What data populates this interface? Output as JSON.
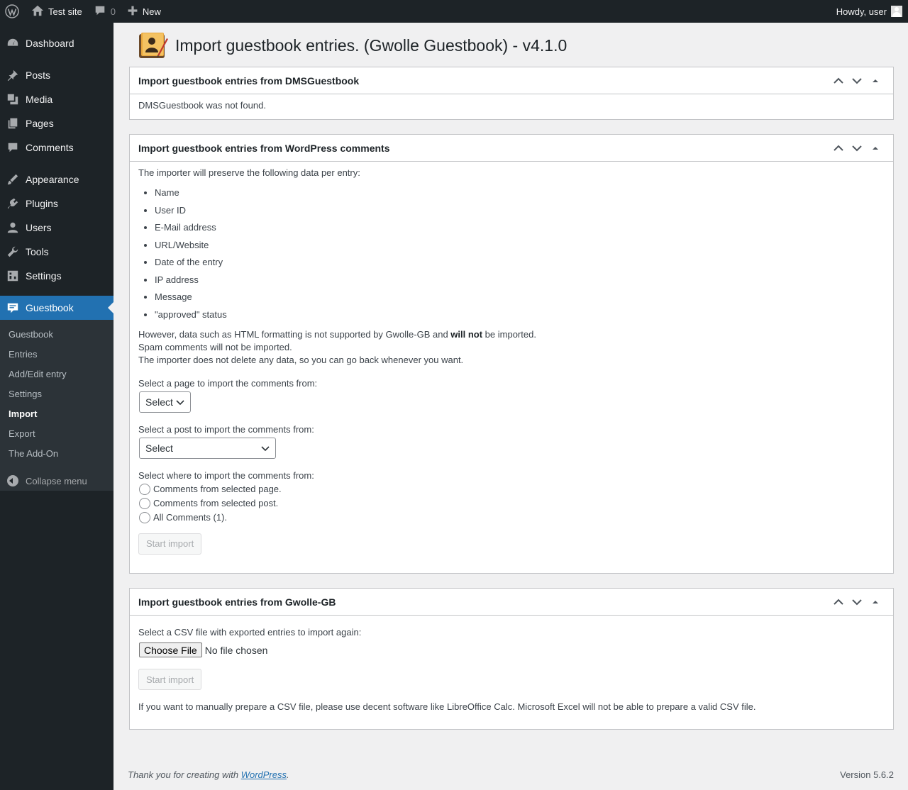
{
  "adminbar": {
    "site_name": "Test site",
    "comments_count": "0",
    "new_label": "New",
    "howdy": "Howdy, user"
  },
  "sidebar": {
    "items": [
      {
        "label": "Dashboard",
        "icon": "dashboard-icon"
      },
      {
        "label": "Posts",
        "icon": "pin-icon"
      },
      {
        "label": "Media",
        "icon": "media-icon"
      },
      {
        "label": "Pages",
        "icon": "pages-icon"
      },
      {
        "label": "Comments",
        "icon": "comment-icon"
      },
      {
        "label": "Appearance",
        "icon": "brush-icon"
      },
      {
        "label": "Plugins",
        "icon": "plugin-icon"
      },
      {
        "label": "Users",
        "icon": "user-icon"
      },
      {
        "label": "Tools",
        "icon": "wrench-icon"
      },
      {
        "label": "Settings",
        "icon": "settings-icon"
      },
      {
        "label": "Guestbook",
        "icon": "guestbook-icon"
      }
    ],
    "submenu": [
      "Guestbook",
      "Entries",
      "Add/Edit entry",
      "Settings",
      "Import",
      "Export",
      "The Add-On"
    ],
    "collapse": "Collapse menu"
  },
  "page": {
    "title": "Import guestbook entries. (Gwolle Guestbook) - v4.1.0"
  },
  "box1": {
    "title": "Import guestbook entries from DMSGuestbook",
    "text": "DMSGuestbook was not found."
  },
  "box2": {
    "title": "Import guestbook entries from WordPress comments",
    "intro": "The importer will preserve the following data per entry:",
    "list": [
      "Name",
      "User ID",
      "E-Mail address",
      "URL/Website",
      "Date of the entry",
      "IP address",
      "Message",
      "\"approved\" status"
    ],
    "note_before": "However, data such as HTML formatting is not supported by Gwolle-GB and ",
    "note_bold": "will not",
    "note_after": " be imported.",
    "note2": "Spam comments will not be imported.",
    "note3": "The importer does not delete any data, so you can go back whenever you want.",
    "page_label": "Select a page to import the comments from:",
    "page_select": "Select",
    "post_label": "Select a post to import the comments from:",
    "post_select": "Select",
    "where_label": "Select where to import the comments from:",
    "radios": [
      "Comments from selected page.",
      "Comments from selected post.",
      "All Comments (1)."
    ],
    "button": "Start import"
  },
  "box3": {
    "title": "Import guestbook entries from Gwolle-GB",
    "csv_label": "Select a CSV file with exported entries to import again:",
    "choose_file": "Choose File",
    "no_file": "No file chosen",
    "button": "Start import",
    "note": "If you want to manually prepare a CSV file, please use decent software like LibreOffice Calc. Microsoft Excel will not be able to prepare a valid CSV file."
  },
  "footer": {
    "thanks_before": "Thank you for creating with ",
    "thanks_link": "WordPress",
    "thanks_after": ".",
    "version": "Version 5.6.2"
  }
}
